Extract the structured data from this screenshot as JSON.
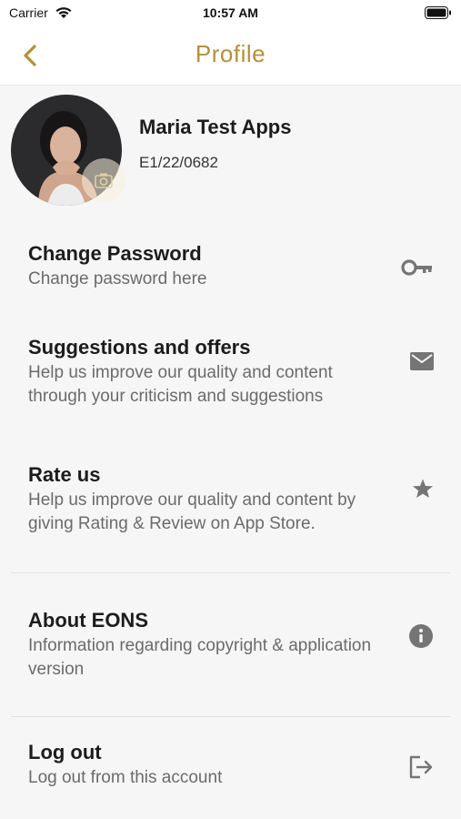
{
  "status_bar": {
    "carrier": "Carrier",
    "time": "10:57 AM"
  },
  "nav": {
    "title": "Profile",
    "back_icon": "chevron-left-icon"
  },
  "colors": {
    "accent": "#b79036",
    "icon_gray": "#757575",
    "text_primary": "#1c1c1c",
    "text_secondary": "#6b6b6b"
  },
  "profile": {
    "name": "Maria Test Apps",
    "id": "E1/22/0682",
    "camera_icon": "camera-icon"
  },
  "menu": [
    {
      "title": "Change Password",
      "description": "Change password here",
      "icon": "key-icon"
    },
    {
      "title": "Suggestions and offers",
      "description": "Help us improve our quality and content through your criticism and suggestions",
      "icon": "mail-icon"
    },
    {
      "title": "Rate us",
      "description": "Help us improve our quality and content by giving Rating & Review on App Store.",
      "icon": "star-icon"
    },
    {
      "title": "About EONS",
      "description": "Information regarding copyright & application version",
      "icon": "info-icon"
    },
    {
      "title": "Log out",
      "description": "Log out from this account",
      "icon": "logout-icon"
    }
  ]
}
